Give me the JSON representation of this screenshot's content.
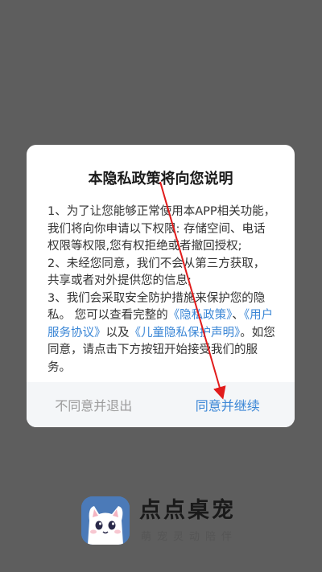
{
  "dialog": {
    "title": "本隐私政策将向您说明",
    "paragraph1": "1、为了让您能够正常使用本APP相关功能，我们将向你申请以下权限: 存储空间、电话权限等权限,您有权拒绝或者撤回授权;",
    "paragraph2": "2、未经您同意，我们不会从第三方获取，共享或者对外提供您的信息;",
    "paragraph3_prefix": "3、我们会采取安全防护措施来保护您的隐私。 您可以查看完整的",
    "privacy_link": "《隐私政策》",
    "sep1": "、",
    "terms_link": "《用户服务协议》",
    "sep2": "以及",
    "child_link": "《儿童隐私保护声明》",
    "paragraph3_suffix": "。如您同意，请点击下方按钮开始接受我们的服务。",
    "decline_label": "不同意并退出",
    "accept_label": "同意并继续"
  },
  "brand": {
    "app_name": "点点桌宠",
    "slogan": "萌宠灵动陪伴"
  },
  "colors": {
    "overlay": "#5e5e5e",
    "link": "#3a86d6",
    "arrow": "#e11b1b"
  }
}
